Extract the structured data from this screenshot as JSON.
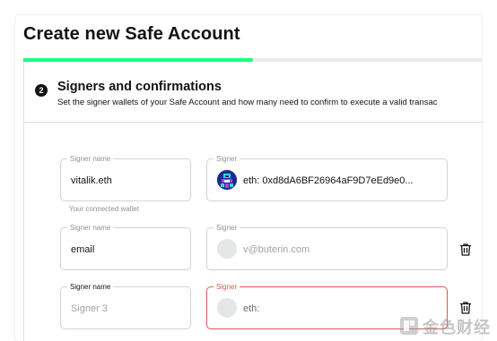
{
  "page": {
    "title": "Create new Safe Account",
    "progress_fraction": 0.5
  },
  "step": {
    "number": "2",
    "title": "Signers and confirmations",
    "description": "Set the signer wallets of your Safe Account and how many need to confirm to execute a valid transac"
  },
  "signers": [
    {
      "name_label": "Signer name",
      "name_value": "vitalik.eth",
      "name_is_placeholder": false,
      "helper": "Your connected wallet",
      "address_label": "Signer",
      "address_value": "eth: 0xd8dA6BF26964aF9D7eEd9e0...",
      "address_is_placeholder": false,
      "avatar_icon": "blockie-avatar-icon",
      "removable": false
    },
    {
      "name_label": "Signer name",
      "name_value": "email",
      "name_is_placeholder": false,
      "address_label": "Signer",
      "address_value": "v@buterin.com",
      "address_is_placeholder": true,
      "avatar_icon": "empty-avatar-icon",
      "removable": true
    },
    {
      "name_label": "Signer name",
      "name_value": "Signer 3",
      "name_is_placeholder": true,
      "address_label": "Signer",
      "address_value": "eth:",
      "address_is_placeholder": false,
      "address_error": true,
      "avatar_icon": "empty-avatar-icon",
      "removable": true
    }
  ],
  "icons": {
    "delete": "trash-icon",
    "watermark": "jinse-logo-icon"
  },
  "watermark": {
    "text": "金色财经"
  },
  "colors": {
    "progress": "#12ff80",
    "error": "#d65a5a",
    "text": "#121312",
    "muted": "#8f9294"
  }
}
